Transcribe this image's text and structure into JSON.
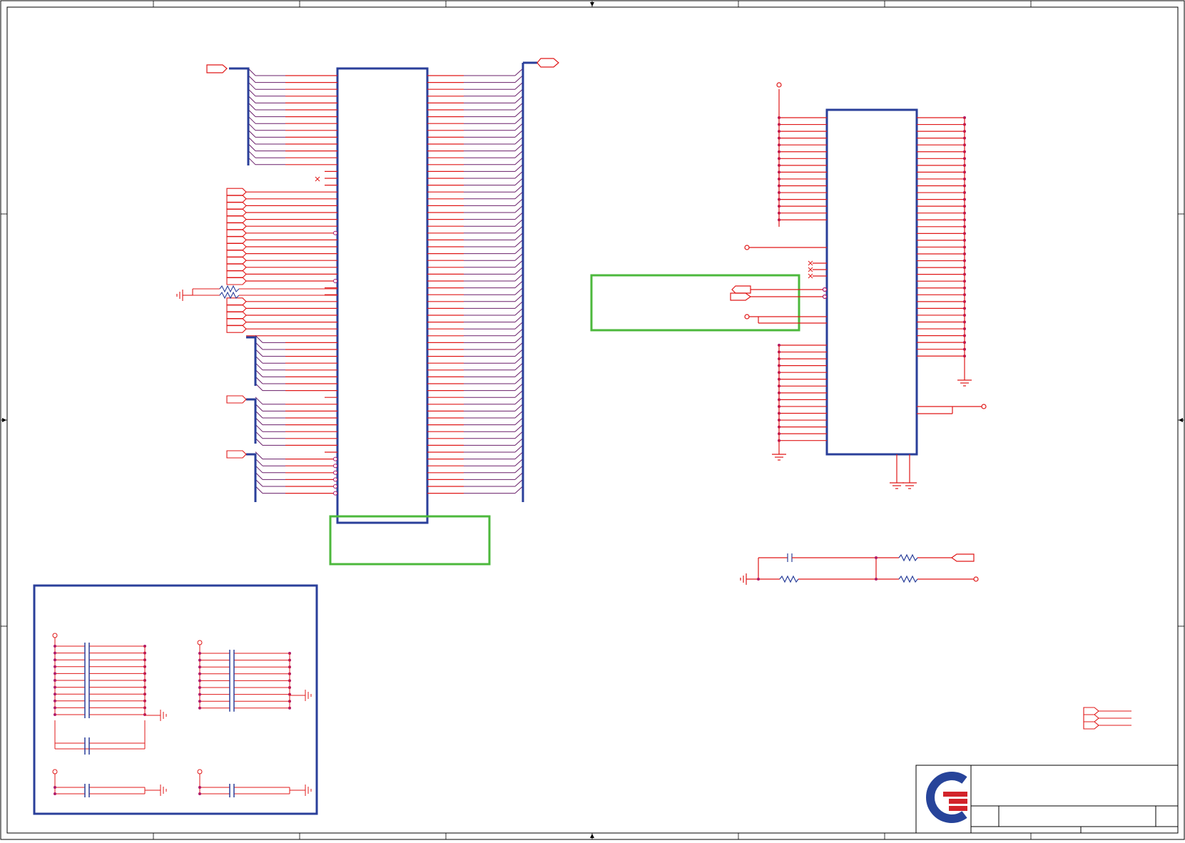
{
  "diagram": {
    "type": "electronic-schematic",
    "colors": {
      "frame": "#000000",
      "wire": "#e01818",
      "bus": "#2a3f9a",
      "component": "#2a3f9a",
      "highlight": "#4cb83c",
      "net": "#6a1f6a",
      "logo_blue": "#27449a",
      "logo_red": "#d2232a"
    },
    "parts": [
      "connector-u1",
      "connector-u2",
      "decoupling-capacitor-block",
      "rc-filter-network",
      "title-block"
    ]
  }
}
